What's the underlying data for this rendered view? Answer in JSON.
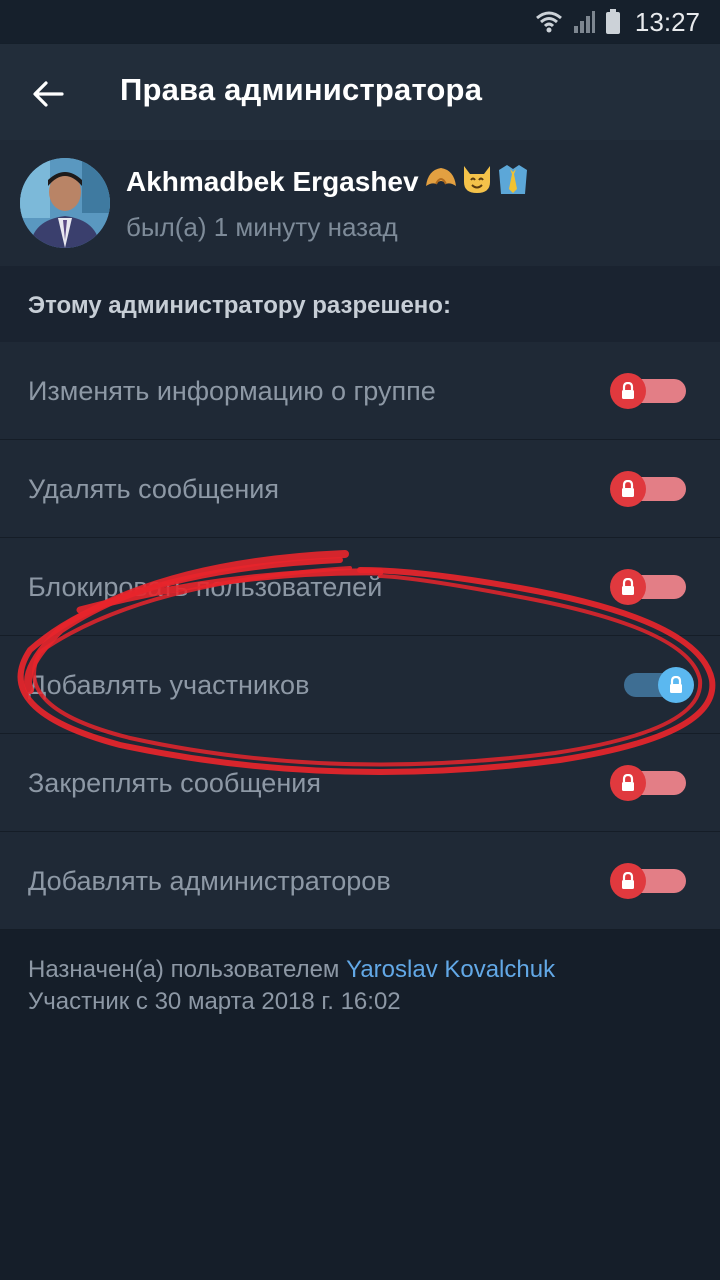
{
  "status_bar": {
    "time": "13:27",
    "icons": [
      "wifi-icon",
      "signal-icon",
      "battery-icon"
    ]
  },
  "header": {
    "title": "Права администратора",
    "back_icon": "arrow-left-icon"
  },
  "profile": {
    "name": "Akhmadbek Ergashev",
    "emoji": [
      "croissant-emoji",
      "cat-emoji",
      "shirt-tie-emoji"
    ],
    "status": "был(а) 1 минуту назад"
  },
  "section": {
    "title": "Этому администратору разрешено:"
  },
  "permissions": [
    {
      "label": "Изменять информацию о группе",
      "enabled": false
    },
    {
      "label": "Удалять сообщения",
      "enabled": false
    },
    {
      "label": "Блокировать пользователей",
      "enabled": false
    },
    {
      "label": "Добавлять участников",
      "enabled": true
    },
    {
      "label": "Закреплять сообщения",
      "enabled": false
    },
    {
      "label": "Добавлять администраторов",
      "enabled": false
    }
  ],
  "footer": {
    "assigned_prefix": "Назначен(а) пользователем ",
    "assigned_by": "Yaroslav Kovalchuk",
    "member_since": "Участник с 30 марта 2018 г. 16:02"
  },
  "colors": {
    "background": "#1a2330",
    "toggle_off": "#e0393e",
    "toggle_on": "#5bb8f0",
    "link": "#62a8e6",
    "annotation": "#e8252b"
  }
}
